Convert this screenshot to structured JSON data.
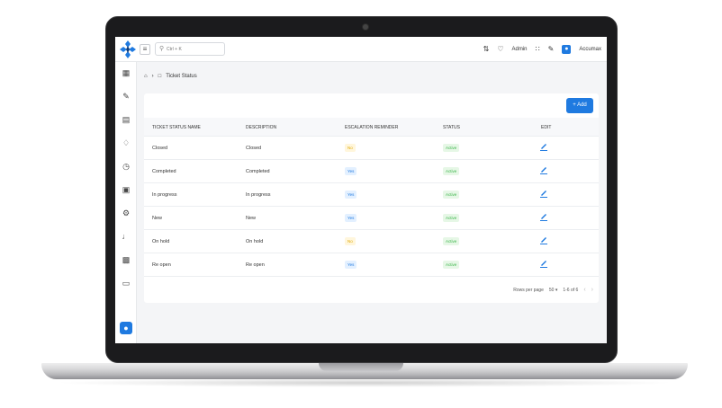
{
  "topbar": {
    "menu_icon": "≡",
    "search_placeholder": "Ctrl + K",
    "admin_label": "Admin",
    "user_name": "Accumax",
    "icons": [
      "translate-icon",
      "bell-icon",
      "fullscreen-icon",
      "brush-icon",
      "user-icon"
    ]
  },
  "breadcrumb": {
    "current": "Ticket Status"
  },
  "toolbar": {
    "add_label": "+ Add"
  },
  "table": {
    "headers": [
      "TICKET STATUS NAME",
      "DESCRIPTION",
      "ESCALATION REMINDER",
      "STATUS",
      "EDIT"
    ],
    "rows": [
      {
        "name": "Closed",
        "description": "Closed",
        "escalation": "No",
        "status": "Active"
      },
      {
        "name": "Completed",
        "description": "Completed",
        "escalation": "Yes",
        "status": "Active"
      },
      {
        "name": "In progress",
        "description": "In progress",
        "escalation": "Yes",
        "status": "Active"
      },
      {
        "name": "New",
        "description": "New",
        "escalation": "Yes",
        "status": "Active"
      },
      {
        "name": "On hold",
        "description": "On hold",
        "escalation": "No",
        "status": "Active"
      },
      {
        "name": "Re open",
        "description": "Re open",
        "escalation": "Yes",
        "status": "Active"
      }
    ]
  },
  "pagination": {
    "rows_per_page_label": "Rows per page",
    "rows_per_page_value": "50",
    "range": "1-6 of 6"
  },
  "colors": {
    "primary": "#1f7ae0",
    "yes_bg": "#e3f0ff",
    "yes_fg": "#1f7ae0",
    "no_bg": "#fff6dc",
    "no_fg": "#e0a800",
    "active_bg": "#e6f7e6",
    "active_fg": "#3bb54a"
  }
}
